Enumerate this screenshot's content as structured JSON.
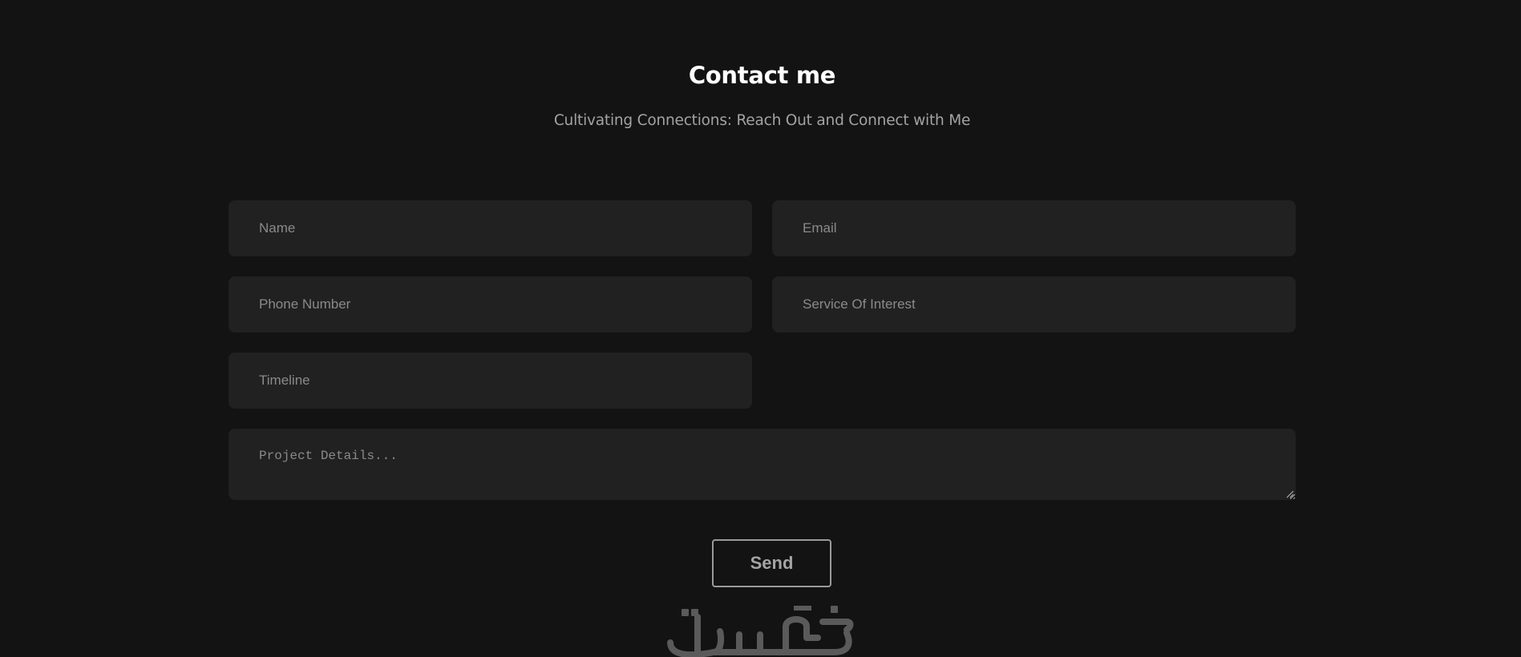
{
  "header": {
    "title": "Contact me",
    "subtitle": "Cultivating Connections: Reach Out and Connect with Me"
  },
  "form": {
    "name_placeholder": "Name",
    "email_placeholder": "Email",
    "phone_placeholder": "Phone Number",
    "service_placeholder": "Service Of Interest",
    "timeline_placeholder": "Timeline",
    "details_placeholder": "Project Details...",
    "send_label": "Send"
  },
  "watermark": {
    "text": "خمسات"
  },
  "colors": {
    "background": "#131313",
    "field": "#212121",
    "title": "#ffffff",
    "subtitle": "#a3a3a3",
    "placeholder": "#8a8a8a",
    "button_border": "#9a9a9a",
    "watermark": "#5a5a5a"
  }
}
